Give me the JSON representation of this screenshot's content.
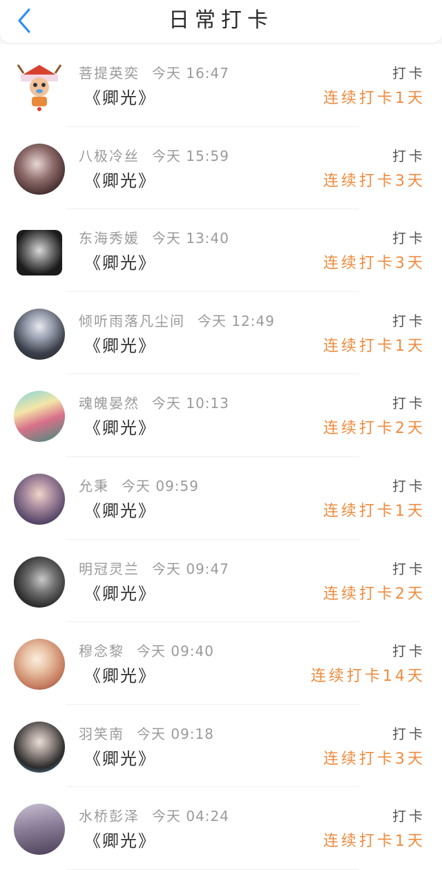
{
  "header": {
    "title": "日常打卡",
    "back_icon": "chevron-left-icon",
    "accent_color": "#2c8cf4"
  },
  "streak_color": "#f08a3c",
  "entries": [
    {
      "name": "菩提英奕",
      "time": "今天 16:47",
      "book": "《卿光》",
      "action": "打卡",
      "streak": "连续打卡1天"
    },
    {
      "name": "八极冷丝",
      "time": "今天 15:59",
      "book": "《卿光》",
      "action": "打卡",
      "streak": "连续打卡3天"
    },
    {
      "name": "东海秀媛",
      "time": "今天 13:40",
      "book": "《卿光》",
      "action": "打卡",
      "streak": "连续打卡3天"
    },
    {
      "name": "倾听雨落凡尘间",
      "time": "今天 12:49",
      "book": "《卿光》",
      "action": "打卡",
      "streak": "连续打卡1天"
    },
    {
      "name": "魂魄晏然",
      "time": "今天 10:13",
      "book": "《卿光》",
      "action": "打卡",
      "streak": "连续打卡2天"
    },
    {
      "name": "允秉",
      "time": "今天 09:59",
      "book": "《卿光》",
      "action": "打卡",
      "streak": "连续打卡1天"
    },
    {
      "name": "明冠灵兰",
      "time": "今天 09:47",
      "book": "《卿光》",
      "action": "打卡",
      "streak": "连续打卡2天"
    },
    {
      "name": "穆念黎",
      "time": "今天 09:40",
      "book": "《卿光》",
      "action": "打卡",
      "streak": "连续打卡14天"
    },
    {
      "name": "羽笑南",
      "time": "今天 09:18",
      "book": "《卿光》",
      "action": "打卡",
      "streak": "连续打卡3天"
    },
    {
      "name": "水桥彭泽",
      "time": "今天 04:24",
      "book": "《卿光》",
      "action": "打卡",
      "streak": "连续打卡1天"
    }
  ]
}
